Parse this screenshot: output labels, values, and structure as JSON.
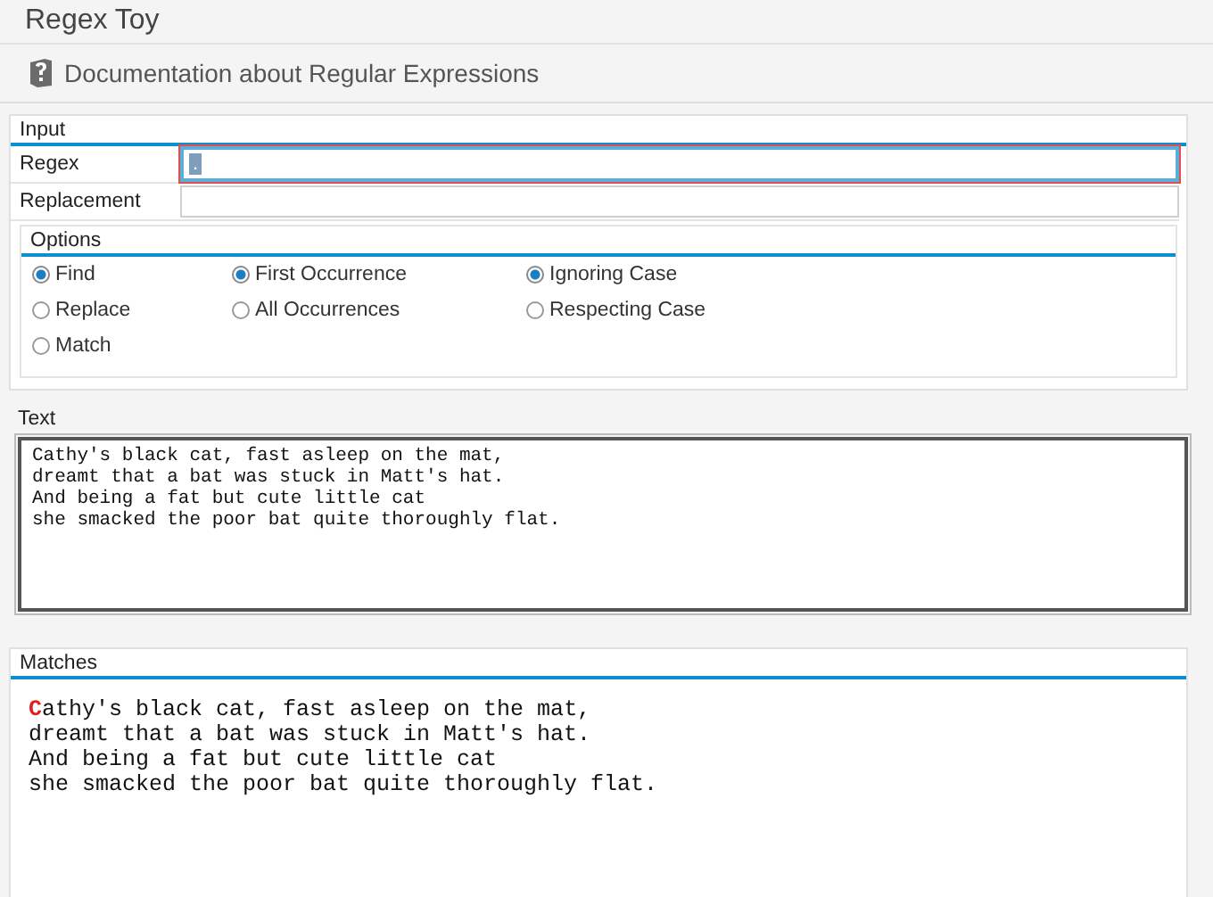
{
  "window": {
    "title": "Regex Toy"
  },
  "toolbar": {
    "documentation_button": "Documentation about Regular Expressions"
  },
  "input": {
    "title": "Input",
    "fields": [
      {
        "label": "Regex",
        "value": ".",
        "focused": true
      },
      {
        "label": "Replacement",
        "focused": false
      }
    ],
    "options": {
      "title": "Options",
      "groups": [
        [
          {
            "label": "Find",
            "selected": true
          },
          {
            "label": "Replace",
            "selected": false
          },
          {
            "label": "Match",
            "selected": false
          }
        ],
        [
          {
            "label": "First Occurrence",
            "selected": true
          },
          {
            "label": "All Occurrences",
            "selected": false
          }
        ],
        [
          {
            "label": "Ignoring Case",
            "selected": true
          },
          {
            "label": "Respecting Case",
            "selected": false
          }
        ]
      ]
    }
  },
  "text": {
    "label": "Text",
    "lines": [
      "Cathy's black cat, fast asleep on the mat,",
      "dreamt that a bat was stuck in Matt's hat.",
      "And being a fat but cute little cat",
      "she smacked the poor bat quite thoroughly flat."
    ]
  },
  "matches": {
    "title": "Matches",
    "lines": [
      [
        {
          "text": "C",
          "highlighted": true
        },
        {
          "text": "athy's black cat, fast asleep on the mat,",
          "highlighted": false
        }
      ],
      [
        {
          "text": "dreamt that a bat was stuck in Matt's hat.",
          "highlighted": false
        }
      ],
      [
        {
          "text": "And being a fat but cute little cat",
          "highlighted": false
        }
      ],
      [
        {
          "text": "she smacked the poor bat quite thoroughly flat.",
          "highlighted": false
        }
      ]
    ]
  }
}
